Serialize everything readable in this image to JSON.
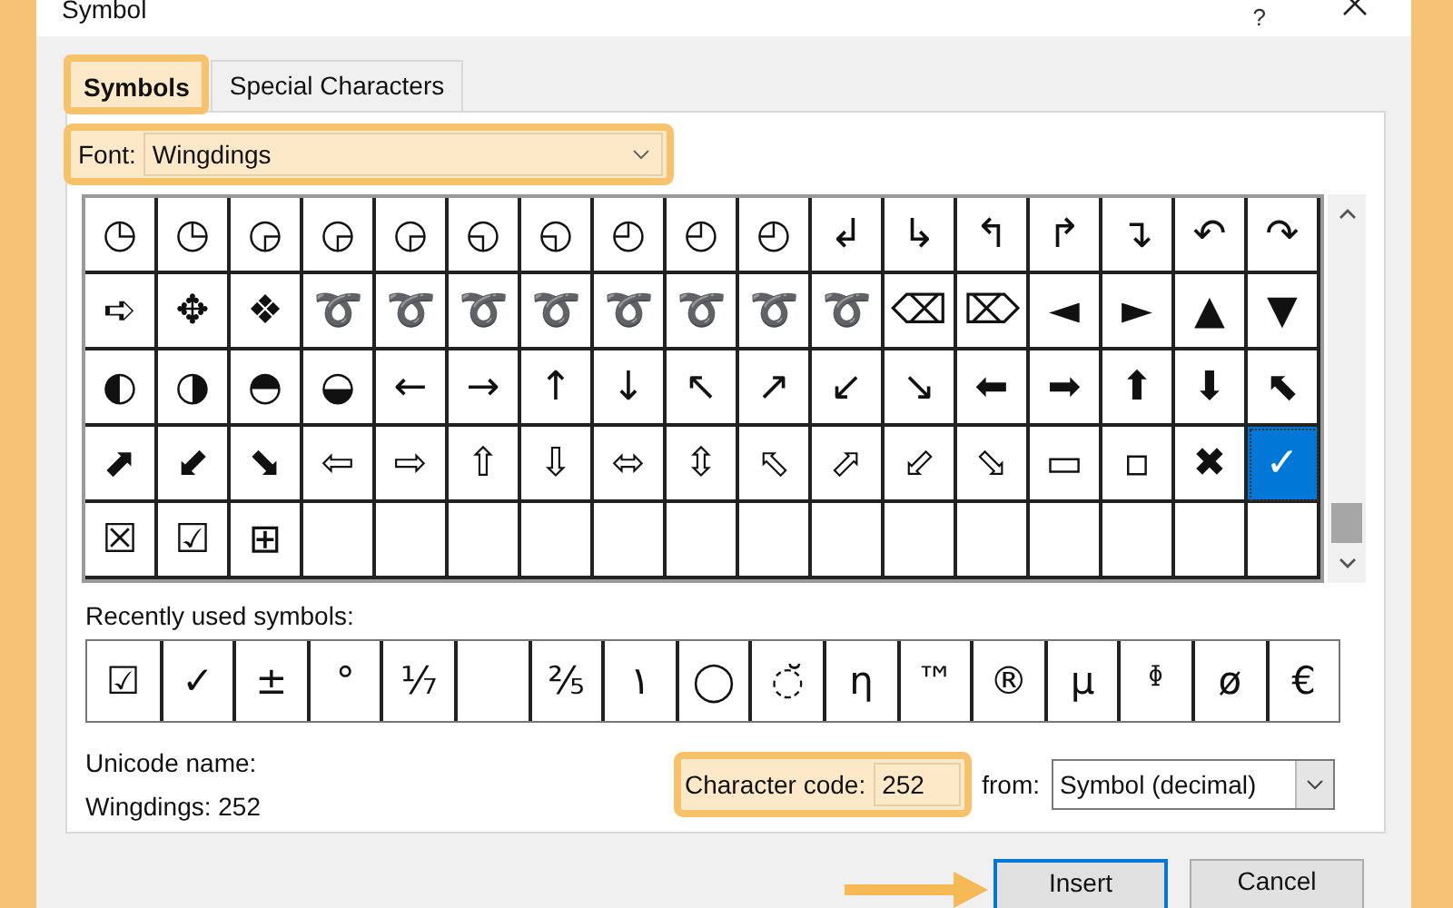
{
  "window": {
    "title": "Symbol",
    "help": "?"
  },
  "tabs": [
    {
      "label": "Symbols",
      "selected": true,
      "highlighted": true
    },
    {
      "label": "Special Characters",
      "selected": false,
      "highlighted": false
    }
  ],
  "font": {
    "label": "Font:",
    "value": "Wingdings",
    "highlighted": true
  },
  "grid": [
    [
      {
        "symbol": "◷",
        "selected": false
      },
      {
        "symbol": "◷",
        "selected": false
      },
      {
        "symbol": "◶",
        "selected": false
      },
      {
        "symbol": "◶",
        "selected": false
      },
      {
        "symbol": "◶",
        "selected": false
      },
      {
        "symbol": "◵",
        "selected": false
      },
      {
        "symbol": "◵",
        "selected": false
      },
      {
        "symbol": "◴",
        "selected": false
      },
      {
        "symbol": "◴",
        "selected": false
      },
      {
        "symbol": "◴",
        "selected": false
      },
      {
        "symbol": "↲",
        "selected": false
      },
      {
        "symbol": "↳",
        "selected": false
      },
      {
        "symbol": "↰",
        "selected": false
      },
      {
        "symbol": "↱",
        "selected": false
      },
      {
        "symbol": "↴",
        "selected": false
      },
      {
        "symbol": "↶",
        "selected": false
      },
      {
        "symbol": "↷",
        "selected": false
      }
    ],
    [
      {
        "symbol": "➪",
        "selected": false
      },
      {
        "symbol": "✥",
        "selected": false
      },
      {
        "symbol": "❖",
        "selected": false
      },
      {
        "symbol": "➰",
        "selected": false
      },
      {
        "symbol": "➰",
        "selected": false
      },
      {
        "symbol": "➰",
        "selected": false
      },
      {
        "symbol": "➰",
        "selected": false
      },
      {
        "symbol": "➰",
        "selected": false
      },
      {
        "symbol": "➰",
        "selected": false
      },
      {
        "symbol": "➰",
        "selected": false
      },
      {
        "symbol": "➰",
        "selected": false
      },
      {
        "symbol": "⌫",
        "selected": false
      },
      {
        "symbol": "⌦",
        "selected": false
      },
      {
        "symbol": "◄",
        "selected": false
      },
      {
        "symbol": "►",
        "selected": false
      },
      {
        "symbol": "▲",
        "selected": false
      },
      {
        "symbol": "▼",
        "selected": false
      }
    ],
    [
      {
        "symbol": "◐",
        "selected": false
      },
      {
        "symbol": "◑",
        "selected": false
      },
      {
        "symbol": "◓",
        "selected": false
      },
      {
        "symbol": "◒",
        "selected": false
      },
      {
        "symbol": "←",
        "selected": false
      },
      {
        "symbol": "→",
        "selected": false
      },
      {
        "symbol": "↑",
        "selected": false
      },
      {
        "symbol": "↓",
        "selected": false
      },
      {
        "symbol": "↖",
        "selected": false
      },
      {
        "symbol": "↗",
        "selected": false
      },
      {
        "symbol": "↙",
        "selected": false
      },
      {
        "symbol": "↘",
        "selected": false
      },
      {
        "symbol": "⬅",
        "selected": false
      },
      {
        "symbol": "➡",
        "selected": false
      },
      {
        "symbol": "⬆",
        "selected": false
      },
      {
        "symbol": "⬇",
        "selected": false
      },
      {
        "symbol": "⬉",
        "selected": false
      }
    ],
    [
      {
        "symbol": "⬈",
        "selected": false
      },
      {
        "symbol": "⬋",
        "selected": false
      },
      {
        "symbol": "⬊",
        "selected": false
      },
      {
        "symbol": "⇦",
        "selected": false
      },
      {
        "symbol": "⇨",
        "selected": false
      },
      {
        "symbol": "⇧",
        "selected": false
      },
      {
        "symbol": "⇩",
        "selected": false
      },
      {
        "symbol": "⬄",
        "selected": false
      },
      {
        "symbol": "⇳",
        "selected": false
      },
      {
        "symbol": "⬁",
        "selected": false
      },
      {
        "symbol": "⬀",
        "selected": false
      },
      {
        "symbol": "⬃",
        "selected": false
      },
      {
        "symbol": "⬂",
        "selected": false
      },
      {
        "symbol": "▭",
        "selected": false
      },
      {
        "symbol": "▫",
        "selected": false
      },
      {
        "symbol": "✖",
        "selected": false
      },
      {
        "symbol": "✓",
        "selected": true
      }
    ],
    [
      {
        "symbol": "☒",
        "selected": false
      },
      {
        "symbol": "☑",
        "selected": false
      },
      {
        "symbol": "⊞",
        "selected": false
      }
    ]
  ],
  "recent": {
    "label": "Recently used symbols:",
    "symbols": [
      {
        "kind": "glyph",
        "symbol": "☑"
      },
      {
        "kind": "glyph",
        "symbol": "✓"
      },
      {
        "kind": "glyph",
        "symbol": "±"
      },
      {
        "kind": "glyph",
        "symbol": "°"
      },
      {
        "kind": "glyph",
        "symbol": "⅐"
      },
      {
        "kind": "blank"
      },
      {
        "kind": "glyph",
        "symbol": "⅖"
      },
      {
        "kind": "glyph",
        "symbol": "١"
      },
      {
        "kind": "glyph",
        "symbol": "◯"
      },
      {
        "kind": "glyph",
        "symbol": "◌̆"
      },
      {
        "kind": "glyph",
        "symbol": "η"
      },
      {
        "kind": "glyph",
        "symbol": "™"
      },
      {
        "kind": "glyph",
        "symbol": "®"
      },
      {
        "kind": "glyph",
        "symbol": "µ"
      },
      {
        "kind": "glyph",
        "symbol": "ᶲ"
      },
      {
        "kind": "glyph",
        "symbol": "ø"
      },
      {
        "kind": "glyph",
        "symbol": "€"
      }
    ]
  },
  "unicode_name": {
    "label": "Unicode name:",
    "value": "Wingdings: 252"
  },
  "character_code": {
    "label": "Character code:",
    "value": "252",
    "highlighted": true
  },
  "from": {
    "label": "from:",
    "value": "Symbol (decimal)"
  },
  "buttons": [
    {
      "label": "Insert",
      "focused": true,
      "pointed": true
    },
    {
      "label": "Cancel",
      "focused": false,
      "pointed": false
    }
  ]
}
